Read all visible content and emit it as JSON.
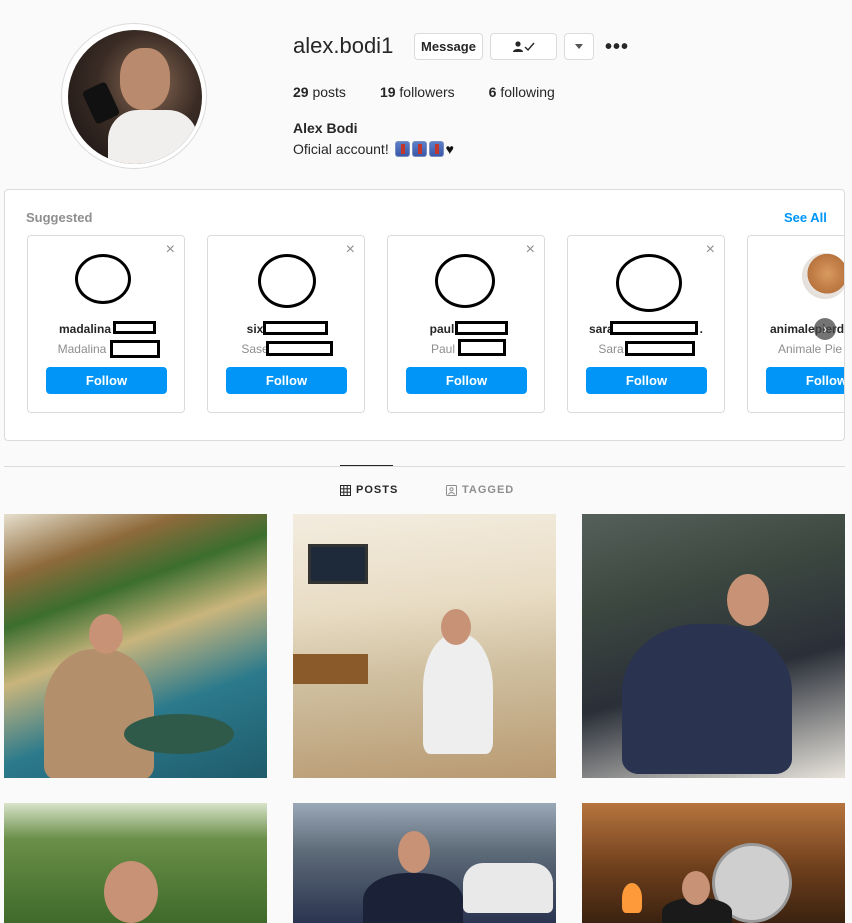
{
  "profile": {
    "username": "alex.bodi1",
    "message_label": "Message",
    "following_icon": "person-check-icon",
    "dropdown_icon": "caret-down-icon",
    "more_icon": "more-options-icon",
    "more_label": "•••",
    "posts_count": "29",
    "posts_label": "posts",
    "followers_count": "19",
    "followers_label": "followers",
    "following_count": "6",
    "following_label": "following",
    "full_name": "Alex Bodi",
    "bio": "Oficial account!"
  },
  "suggested": {
    "title": "Suggested",
    "see_all": "See All",
    "close_glyph": "×",
    "cards": [
      {
        "username": "madalina",
        "subtitle": "Madalina",
        "follow_label": "Follow"
      },
      {
        "username": "six",
        "subtitle": "Sase",
        "follow_label": "Follow"
      },
      {
        "username": "paul",
        "subtitle": "Paul",
        "follow_label": "Follow"
      },
      {
        "username": "sara",
        "suffix": ".",
        "subtitle": "Sara",
        "follow_label": "Follow"
      },
      {
        "username": "animalepierd",
        "subtitle": "Animale Pie",
        "follow_label": "Follow"
      }
    ]
  },
  "tabs": {
    "posts": "POSTS",
    "tagged": "TAGGED"
  },
  "colors": {
    "primary_blue": "#0095f6",
    "border": "#dbdbdb",
    "muted_text": "#8e8e8e",
    "background": "#fafafa"
  }
}
